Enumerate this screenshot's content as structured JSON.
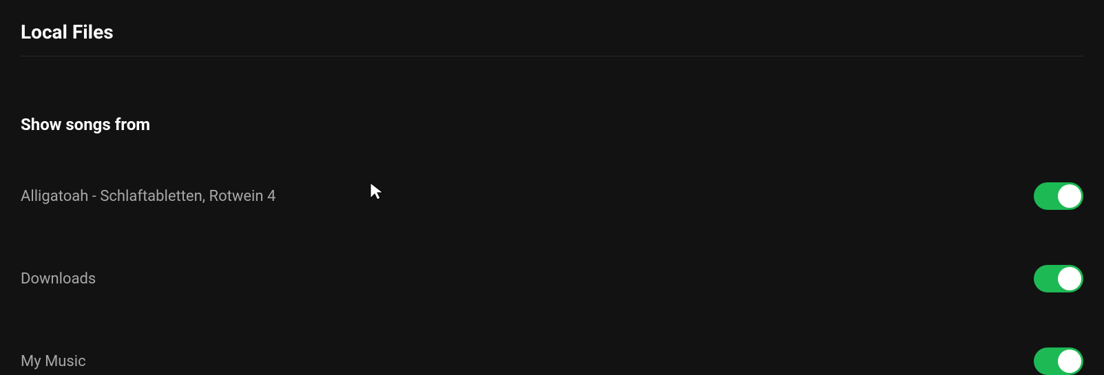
{
  "section": {
    "title": "Local Files",
    "subsection_title": "Show songs from"
  },
  "sources": [
    {
      "label": "Alligatoah - Schlaftabletten, Rotwein 4",
      "enabled": true
    },
    {
      "label": "Downloads",
      "enabled": true
    },
    {
      "label": "My Music",
      "enabled": true
    }
  ],
  "colors": {
    "toggle_active": "#1db954",
    "background": "#121212",
    "text_primary": "#ffffff",
    "text_secondary": "#a7a7a7"
  }
}
